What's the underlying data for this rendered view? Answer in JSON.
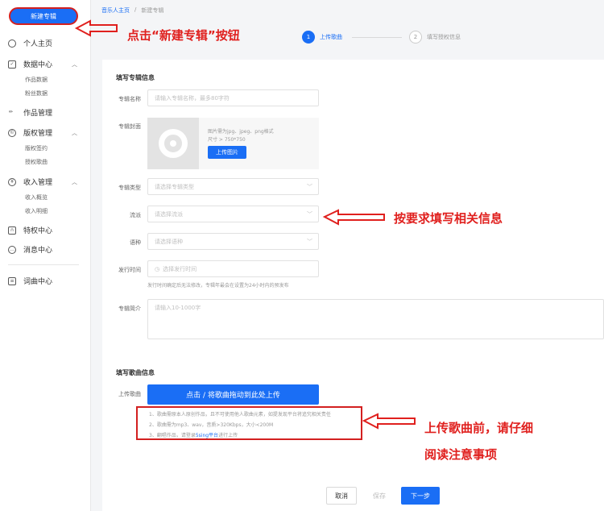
{
  "sidebar": {
    "new_album": "新建专辑",
    "items": [
      {
        "label": "个人主页"
      },
      {
        "label": "数据中心"
      },
      {
        "label": "作品管理"
      },
      {
        "label": "版权管理"
      },
      {
        "label": "收入管理"
      },
      {
        "label": "特权中心"
      },
      {
        "label": "消息中心"
      },
      {
        "label": "词曲中心"
      }
    ],
    "sub": {
      "works_data": "作品数据",
      "fans_data": "粉丝数据",
      "copyright_sign": "版权签约",
      "licensed_songs": "授权歌曲",
      "income_overview": "收入概览",
      "income_detail": "收入明细"
    }
  },
  "breadcrumb": {
    "home": "音乐人主页",
    "sep": "/",
    "current": "新建专辑"
  },
  "steps": [
    {
      "num": "1",
      "label": "上传歌曲"
    },
    {
      "num": "2",
      "label": "填写授权信息"
    }
  ],
  "album_section": {
    "title": "填写专辑信息",
    "name_label": "专辑名称",
    "name_placeholder": "请输入专辑名称，最多80字符",
    "cover_label": "专辑封面",
    "cover_note1": "图片需为jpg、jpeg、png格式",
    "cover_note2": "尺寸 > 750*750",
    "upload_image": "上传图片",
    "type_label": "专辑类型",
    "type_placeholder": "请选择专辑类型",
    "genre_label": "流派",
    "genre_placeholder": "请选择流派",
    "lang_label": "语种",
    "lang_placeholder": "请选择语种",
    "release_label": "发行时间",
    "release_placeholder": "选择发行时间",
    "release_hint": "发行时间确定后无法修改，专辑年最会在设置为24小时内的预发布",
    "intro_label": "专辑简介",
    "intro_placeholder": "请输入10-1000字"
  },
  "song_section": {
    "title": "填写歌曲信息",
    "upload_label": "上传歌曲",
    "upload_button": "点击 / 将歌曲拖动到此处上传",
    "note1": "1、歌曲需原本人原创作品，且不可使用他人歌曲元素，如提发现平台将追究相关责任",
    "note2": "2、歌曲需为mp3、wav，音质>320Kbps，大小<200M",
    "note3_pre": "3、翻唱作品，请登录",
    "note3_link": "5sing平台",
    "note3_post": "进行上传"
  },
  "footer": {
    "cancel": "取消",
    "save": "保存",
    "next": "下一步"
  },
  "annotations": {
    "click_new": "点击“新建专辑”按钮",
    "fill_info": "按要求填写相关信息",
    "before_upload_1": "上传歌曲前，请仔细",
    "before_upload_2": "阅读注意事项"
  },
  "colors": {
    "accent": "#1a6ef5",
    "annotation": "#e0201e"
  }
}
